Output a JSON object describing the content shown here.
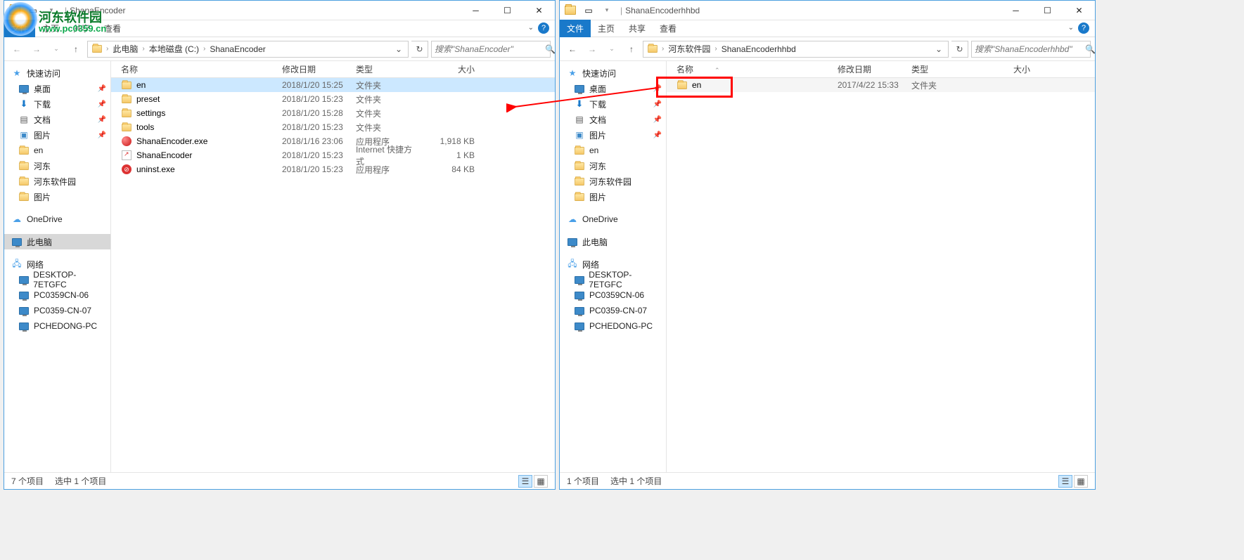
{
  "watermark": {
    "brand": "河东软件园",
    "url": "www.pc0359.cn"
  },
  "left": {
    "title": "ShanaEncoder",
    "ribbon": {
      "file": "文件",
      "home": "主页",
      "share": "共享",
      "view": "查看"
    },
    "breadcrumb": [
      "此电脑",
      "本地磁盘 (C:)",
      "ShanaEncoder"
    ],
    "search_placeholder": "搜索\"ShanaEncoder\"",
    "nav": {
      "quick": {
        "label": "快速访问",
        "items": [
          {
            "label": "桌面",
            "pin": true,
            "icon": "desktop"
          },
          {
            "label": "下载",
            "pin": true,
            "icon": "download"
          },
          {
            "label": "文档",
            "pin": true,
            "icon": "document"
          },
          {
            "label": "图片",
            "pin": true,
            "icon": "picture"
          },
          {
            "label": "en",
            "pin": false,
            "icon": "folder"
          },
          {
            "label": "河东",
            "pin": false,
            "icon": "folder"
          },
          {
            "label": "河东软件园",
            "pin": false,
            "icon": "folder"
          },
          {
            "label": "图片",
            "pin": false,
            "icon": "folder"
          }
        ]
      },
      "onedrive": "OneDrive",
      "thispc": "此电脑",
      "network": {
        "label": "网络",
        "items": [
          "DESKTOP-7ETGFC",
          "PC0359CN-06",
          "PC0359-CN-07",
          "PCHEDONG-PC"
        ]
      }
    },
    "columns": {
      "name": "名称",
      "date": "修改日期",
      "type": "类型",
      "size": "大小"
    },
    "files": [
      {
        "name": "en",
        "date": "2018/1/20 15:25",
        "type": "文件夹",
        "size": "",
        "icon": "folder",
        "selected": true
      },
      {
        "name": "preset",
        "date": "2018/1/20 15:23",
        "type": "文件夹",
        "size": "",
        "icon": "folder"
      },
      {
        "name": "settings",
        "date": "2018/1/20 15:28",
        "type": "文件夹",
        "size": "",
        "icon": "folder"
      },
      {
        "name": "tools",
        "date": "2018/1/20 15:23",
        "type": "文件夹",
        "size": "",
        "icon": "folder"
      },
      {
        "name": "ShanaEncoder.exe",
        "date": "2018/1/16 23:06",
        "type": "应用程序",
        "size": "1,918 KB",
        "icon": "exe"
      },
      {
        "name": "ShanaEncoder",
        "date": "2018/1/20 15:23",
        "type": "Internet 快捷方式",
        "size": "1 KB",
        "icon": "link"
      },
      {
        "name": "uninst.exe",
        "date": "2018/1/20 15:23",
        "type": "应用程序",
        "size": "84 KB",
        "icon": "uninst"
      }
    ],
    "status": {
      "count": "7 个项目",
      "selected": "选中 1 个项目"
    }
  },
  "right": {
    "title": "ShanaEncoderhhbd",
    "ribbon": {
      "file": "文件",
      "home": "主页",
      "share": "共享",
      "view": "查看"
    },
    "breadcrumb": [
      "河东软件园",
      "ShanaEncoderhhbd"
    ],
    "search_placeholder": "搜索\"ShanaEncoderhhbd\"",
    "nav": {
      "quick": {
        "label": "快速访问",
        "items": [
          {
            "label": "桌面",
            "pin": true,
            "icon": "desktop"
          },
          {
            "label": "下载",
            "pin": true,
            "icon": "download"
          },
          {
            "label": "文档",
            "pin": true,
            "icon": "document"
          },
          {
            "label": "图片",
            "pin": true,
            "icon": "picture"
          },
          {
            "label": "en",
            "pin": false,
            "icon": "folder"
          },
          {
            "label": "河东",
            "pin": false,
            "icon": "folder"
          },
          {
            "label": "河东软件园",
            "pin": false,
            "icon": "folder"
          },
          {
            "label": "图片",
            "pin": false,
            "icon": "folder"
          }
        ]
      },
      "onedrive": "OneDrive",
      "thispc": "此电脑",
      "network": {
        "label": "网络",
        "items": [
          "DESKTOP-7ETGFC",
          "PC0359CN-06",
          "PC0359-CN-07",
          "PCHEDONG-PC"
        ]
      }
    },
    "columns": {
      "name": "名称",
      "date": "修改日期",
      "type": "类型",
      "size": "大小"
    },
    "files": [
      {
        "name": "en",
        "date": "2017/4/22 15:33",
        "type": "文件夹",
        "size": "",
        "icon": "folder",
        "selected": false,
        "highlighted": true
      }
    ],
    "status": {
      "count": "1 个项目",
      "selected": "选中 1 个项目"
    }
  }
}
